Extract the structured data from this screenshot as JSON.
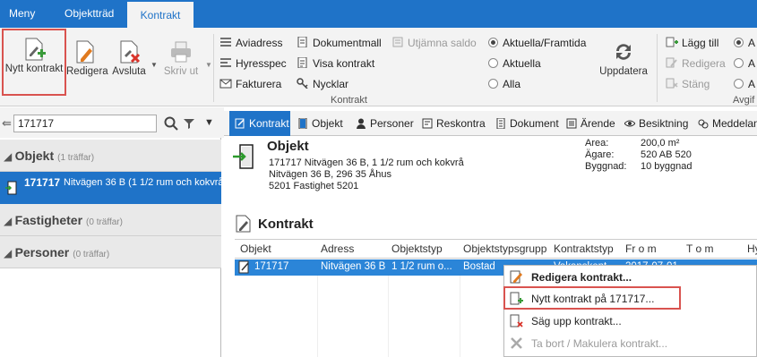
{
  "menubar": {
    "tabs": [
      {
        "label": "Meny"
      },
      {
        "label": "Objektträd"
      },
      {
        "label": "Kontrakt"
      }
    ]
  },
  "ribbon": {
    "new_contract": "Nytt kontrakt",
    "edit": "Redigera",
    "terminate": "Avsluta",
    "print": "Skriv ut",
    "links": [
      "Aviadress",
      "Hyresspec",
      "Fakturera",
      "Dokumentmall",
      "Visa kontrakt",
      "Nycklar",
      "Utjämna saldo"
    ],
    "group_label": "Kontrakt",
    "filters": [
      {
        "label": "Aktuella/Framtida",
        "selected": true
      },
      {
        "label": "Aktuella",
        "selected": false
      },
      {
        "label": "Alla",
        "selected": false
      }
    ],
    "refresh": "Uppdatera",
    "add": "Lägg till",
    "edit2": "Redigera",
    "close": "Stäng",
    "group2_label": "Avgif",
    "radio2": [
      "A",
      "A",
      "A"
    ]
  },
  "search": {
    "value": "171717"
  },
  "results": {
    "groups": [
      {
        "name": "Objekt",
        "count": "(1 träffar)"
      },
      {
        "name": "Fastigheter",
        "count": "(0 träffar)"
      },
      {
        "name": "Personer",
        "count": "(0 träffar)"
      }
    ],
    "selected_item": {
      "id": "171717",
      "text": "Nitvägen 36 B (1 1/2 rum och kokvrå"
    }
  },
  "tabs": [
    "Kontrakt",
    "Objekt",
    "Personer",
    "Reskontra",
    "Dokument",
    "Ärende",
    "Besiktning",
    "Meddelan"
  ],
  "object": {
    "heading": "Objekt",
    "line1": "171717 Nitvägen 36 B,  1 1/2 rum och kokvrå",
    "line2": "Nitvägen 36 B, 296 35 Åhus",
    "line3": "5201 Fastighet 5201",
    "props": [
      {
        "k": "Area:",
        "v": "200,0 m²"
      },
      {
        "k": "Ägare:",
        "v": "520 AB 520"
      },
      {
        "k": "Byggnad:",
        "v": "10 byggnad"
      }
    ]
  },
  "contracts": {
    "heading": "Kontrakt",
    "columns": [
      "Objekt",
      "Adress",
      "Objektstyp",
      "Objektstypsgrupp",
      "Kontraktstyp",
      "Fr o m",
      "T o m",
      "Hy"
    ],
    "row": [
      "171717",
      "Nitvägen 36 B",
      "1 1/2 rum o...",
      "Bostad",
      "Vakanskont...",
      "2017-07-01"
    ]
  },
  "context_menu": {
    "items": [
      {
        "label": "Redigera kontrakt...",
        "bold": true,
        "disabled": false
      },
      {
        "label": "Nytt kontrakt på 171717...",
        "bold": false,
        "disabled": false
      },
      {
        "label": "Säg upp kontrakt...",
        "bold": false,
        "disabled": false
      },
      {
        "label": "Ta bort / Makulera kontrakt...",
        "bold": false,
        "disabled": true
      }
    ]
  },
  "colors": {
    "accent": "#1f73c8",
    "highlight": "#d9534f"
  }
}
